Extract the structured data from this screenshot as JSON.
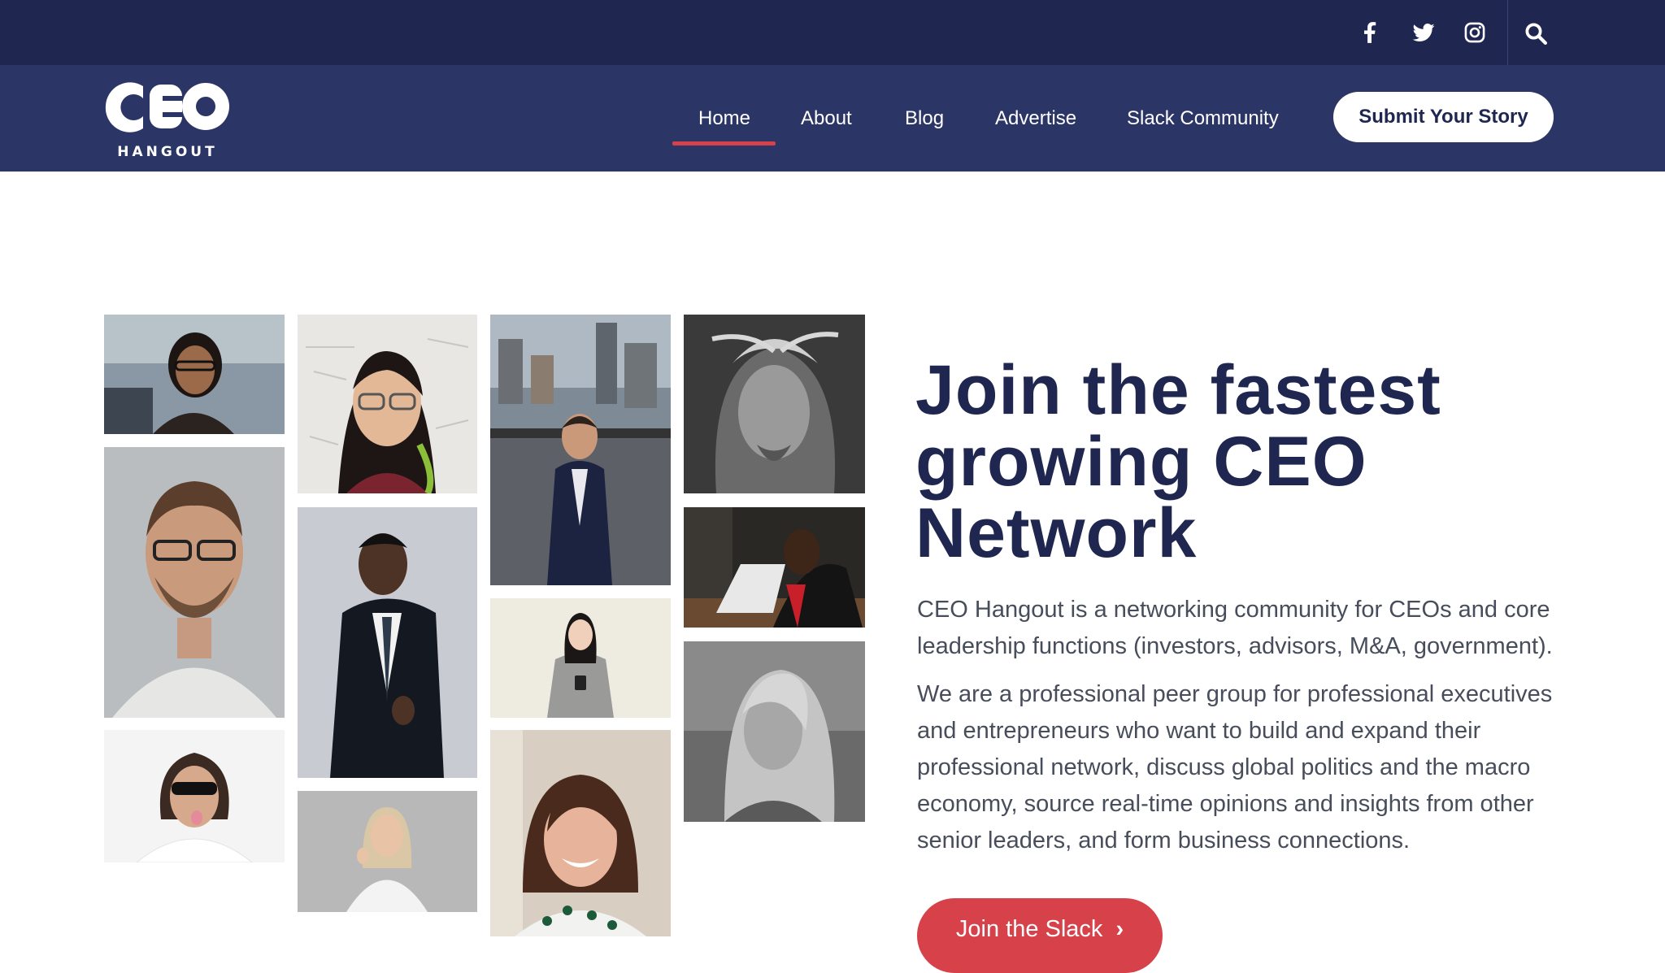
{
  "topbar": {
    "social": [
      {
        "name": "facebook",
        "icon": "facebook-icon"
      },
      {
        "name": "twitter",
        "icon": "twitter-icon"
      },
      {
        "name": "instagram",
        "icon": "instagram-icon"
      }
    ],
    "search_icon": "search-icon"
  },
  "header": {
    "logo": {
      "mark": "CEO",
      "sub": "HANGOUT"
    },
    "nav": [
      {
        "label": "Home",
        "active": true
      },
      {
        "label": "About"
      },
      {
        "label": "Blog"
      },
      {
        "label": "Advertise"
      },
      {
        "label": "Slack Community"
      }
    ],
    "cta_label": "Submit Your Story"
  },
  "hero": {
    "title": "Join the fastest growing CEO Network",
    "para1": "CEO Hangout is a networking community for CEOs and core leadership functions (investors, advisors, M&A, government).",
    "para2": "We are a professional peer group for professional executives and entrepreneurs who want to build and expand their professional network, discuss global politics and the macro economy, source real-time opinions and insights from other senior leaders, and form business connections.",
    "join_label": "Join the Slack"
  },
  "colors": {
    "topbar_bg": "#1f2750",
    "navbar_bg": "#2b3566",
    "accent": "#d6414a",
    "title": "#1f2750",
    "body_text": "#474d5a"
  }
}
